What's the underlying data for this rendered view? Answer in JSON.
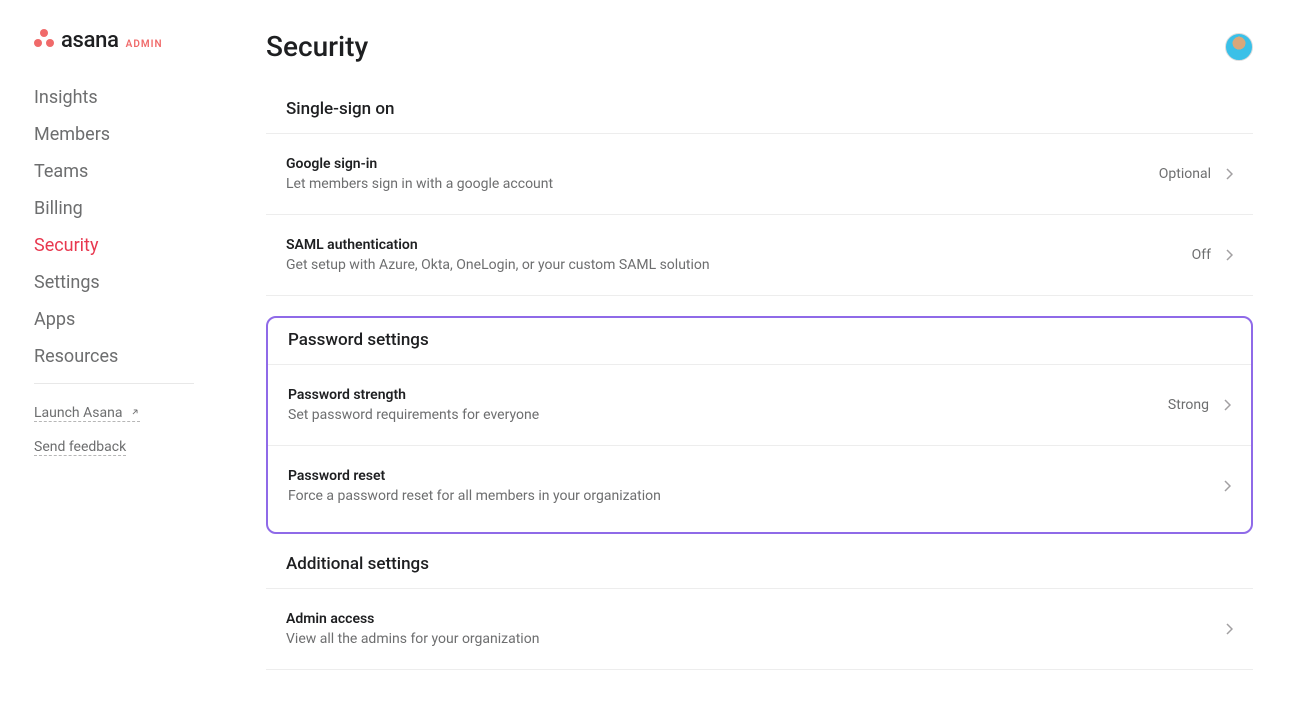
{
  "brand": {
    "name": "asana",
    "suffix": "ADMIN"
  },
  "sidebar": {
    "items": [
      {
        "label": "Insights"
      },
      {
        "label": "Members"
      },
      {
        "label": "Teams"
      },
      {
        "label": "Billing"
      },
      {
        "label": "Security",
        "active": true
      },
      {
        "label": "Settings"
      },
      {
        "label": "Apps"
      },
      {
        "label": "Resources"
      }
    ],
    "footer": {
      "launch": "Launch Asana",
      "feedback": "Send feedback"
    }
  },
  "page": {
    "title": "Security"
  },
  "sections": {
    "sso": {
      "title": "Single-sign on",
      "rows": [
        {
          "name": "Google sign-in",
          "desc": "Let members sign in with a google account",
          "value": "Optional"
        },
        {
          "name": "SAML authentication",
          "desc": "Get setup with Azure, Okta, OneLogin, or your custom SAML solution",
          "value": "Off"
        }
      ]
    },
    "password": {
      "title": "Password settings",
      "rows": [
        {
          "name": "Password strength",
          "desc": "Set password requirements for everyone",
          "value": "Strong"
        },
        {
          "name": "Password reset",
          "desc": "Force a password reset for all members in your organization",
          "value": ""
        }
      ]
    },
    "additional": {
      "title": "Additional settings",
      "rows": [
        {
          "name": "Admin access",
          "desc": "View all the admins for your organization",
          "value": ""
        }
      ]
    }
  }
}
